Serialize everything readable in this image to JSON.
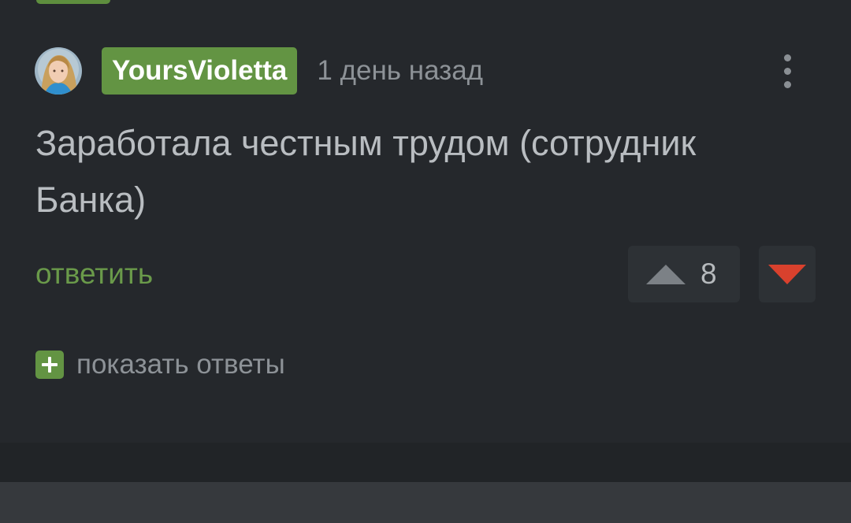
{
  "comment": {
    "username": "YoursVioletta",
    "timestamp": "1 день назад",
    "text": "Заработала честным трудом (сотрудник Банка)",
    "reply_label": "ответить",
    "rating": "8",
    "show_replies_label": "показать ответы"
  },
  "icons": {
    "menu": "more-vertical-icon",
    "upvote": "triangle-up-icon",
    "downvote": "triangle-down-icon",
    "expand": "plus-icon"
  },
  "colors": {
    "background": "#25282c",
    "username_badge": "#639443",
    "reply_link": "#6a9a4a",
    "downvote": "#d9412d",
    "upvote": "#7c8186"
  }
}
